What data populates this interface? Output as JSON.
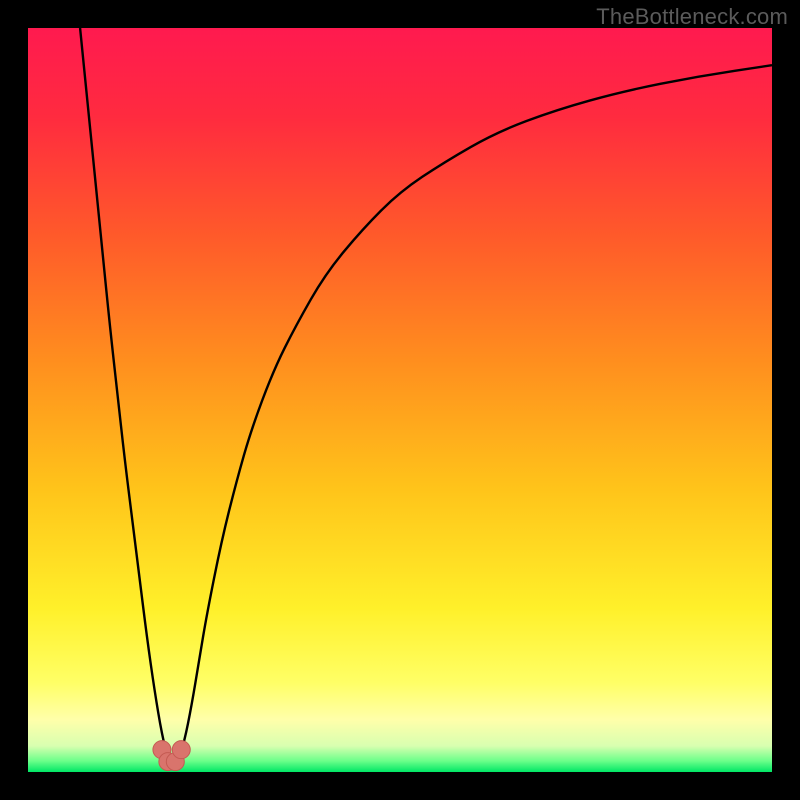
{
  "watermark": "TheBottleneck.com",
  "colors": {
    "frame": "#000000",
    "gradient_stops": [
      {
        "offset": 0.0,
        "color": "#ff1a4f"
      },
      {
        "offset": 0.12,
        "color": "#ff2b3f"
      },
      {
        "offset": 0.28,
        "color": "#ff5a2a"
      },
      {
        "offset": 0.45,
        "color": "#ff8f1e"
      },
      {
        "offset": 0.62,
        "color": "#ffc41a"
      },
      {
        "offset": 0.78,
        "color": "#fff02a"
      },
      {
        "offset": 0.88,
        "color": "#ffff66"
      },
      {
        "offset": 0.93,
        "color": "#ffffaa"
      },
      {
        "offset": 0.965,
        "color": "#d8ffb0"
      },
      {
        "offset": 0.985,
        "color": "#6cff8a"
      },
      {
        "offset": 1.0,
        "color": "#00e765"
      }
    ],
    "curve": "#000000",
    "marker_fill": "#d9746c",
    "marker_stroke": "#c45a52"
  },
  "chart_data": {
    "type": "line",
    "title": "",
    "xlabel": "",
    "ylabel": "",
    "xlim": [
      0,
      100
    ],
    "ylim": [
      0,
      100
    ],
    "note": "Axes are unlabeled; values estimated from pixel positions on a 0–100 normalized scale. y=0 is the bottom (green) edge, y=100 is the top (red) edge. The curve touches y≈0 near x≈18–20 and rises steeply on both sides.",
    "series": [
      {
        "name": "curve",
        "x": [
          7,
          8,
          9,
          10,
          11,
          12,
          13,
          14,
          15,
          16,
          17,
          18,
          19,
          20,
          21,
          22,
          23,
          24,
          26,
          28,
          30,
          33,
          36,
          40,
          45,
          50,
          56,
          63,
          71,
          80,
          90,
          100
        ],
        "y": [
          100,
          90,
          80,
          70,
          60,
          51,
          42,
          34,
          26,
          18,
          11,
          5,
          1,
          1,
          4,
          9,
          15,
          21,
          31,
          39,
          46,
          54,
          60,
          67,
          73,
          78,
          82,
          86,
          89,
          91.5,
          93.5,
          95
        ]
      }
    ],
    "markers": [
      {
        "x": 18.0,
        "y": 3.0
      },
      {
        "x": 18.8,
        "y": 1.4
      },
      {
        "x": 19.8,
        "y": 1.4
      },
      {
        "x": 20.6,
        "y": 3.0
      }
    ]
  }
}
